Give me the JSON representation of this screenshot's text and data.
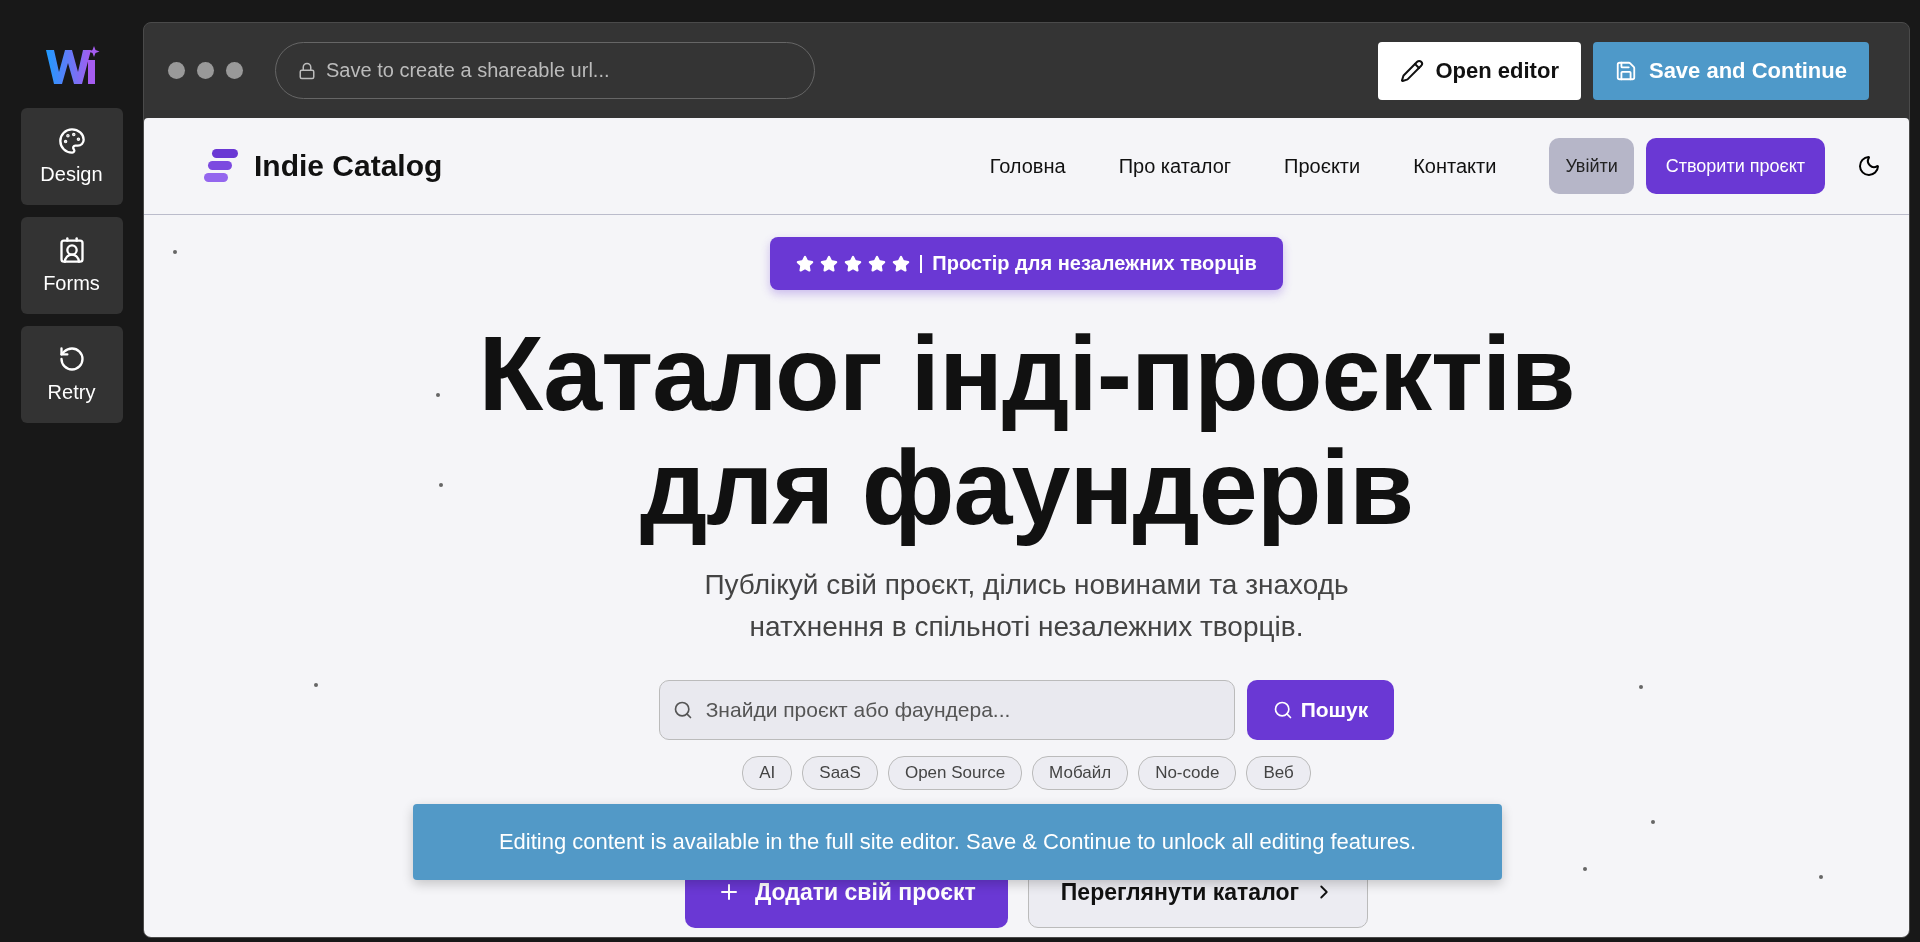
{
  "sidebar": {
    "items": [
      {
        "label": "Design",
        "kind": "palette"
      },
      {
        "label": "Forms",
        "kind": "form"
      },
      {
        "label": "Retry",
        "kind": "retry"
      }
    ]
  },
  "browser": {
    "url_placeholder": "Save to create a shareable url...",
    "buttons": [
      {
        "label": "Open editor",
        "kind": "secondary"
      },
      {
        "label": "Save and Continue",
        "kind": "primary"
      }
    ]
  },
  "site": {
    "brand": "Indie Catalog",
    "nav": [
      "Головна",
      "Про каталог",
      "Проєкти",
      "Контакти"
    ],
    "login": "Увійти",
    "create": "Створити проєкт",
    "badge": {
      "stars": 5,
      "text": "Простір для незалежних творців"
    },
    "title": [
      "Каталог інді-проєктів",
      "для фаундерів"
    ],
    "subtitle": [
      "Публікуй свій проєкт, ділись новинами та знаходь",
      "натхнення в спільноті незалежних творців."
    ],
    "search": {
      "placeholder": "Знайди проєкт або фаундера...",
      "button": "Пошук"
    },
    "tags": [
      "AI",
      "SaaS",
      "Open Source",
      "Мобайл",
      "No-code",
      "Веб"
    ],
    "actions": [
      {
        "label": "Додати свій проєкт",
        "kind": "primary"
      },
      {
        "label": "Переглянути каталог",
        "kind": "secondary"
      }
    ]
  },
  "toast": "Editing content is available in the full site editor. Save & Continue to unlock all editing features."
}
